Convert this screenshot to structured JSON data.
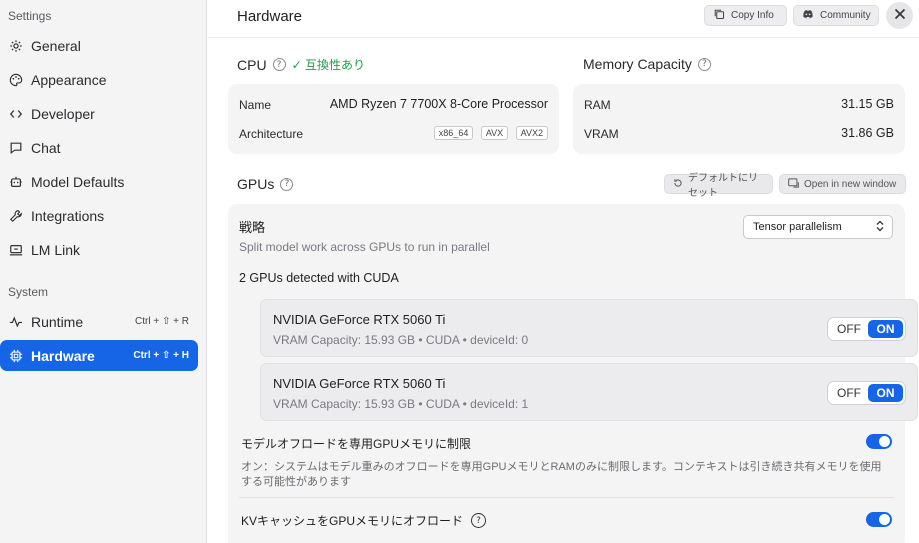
{
  "sidebar": {
    "settings_heading": "Settings",
    "system_heading": "System",
    "items": [
      {
        "label": "General",
        "icon": "gear-icon"
      },
      {
        "label": "Appearance",
        "icon": "palette-icon"
      },
      {
        "label": "Developer",
        "icon": "code-icon"
      },
      {
        "label": "Chat",
        "icon": "chat-icon"
      },
      {
        "label": "Model Defaults",
        "icon": "robot-icon"
      },
      {
        "label": "Integrations",
        "icon": "wrench-icon"
      },
      {
        "label": "LM Link",
        "icon": "link-icon"
      }
    ],
    "system_items": [
      {
        "label": "Runtime",
        "shortcut": "Ctrl + ⇧ + R",
        "icon": "activity-icon"
      },
      {
        "label": "Hardware",
        "shortcut": "Ctrl + ⇧ + H",
        "icon": "chip-icon",
        "active": true
      }
    ]
  },
  "header": {
    "title": "Hardware",
    "copy_info": "Copy Info",
    "community": "Community"
  },
  "cpu": {
    "title": "CPU",
    "compat": "互換性あり",
    "name_label": "Name",
    "name_value": "AMD Ryzen 7 7700X 8-Core Processor",
    "arch_label": "Architecture",
    "arch_tags": [
      "x86_64",
      "AVX",
      "AVX2"
    ]
  },
  "memory": {
    "title": "Memory Capacity",
    "ram_label": "RAM",
    "ram_value": "31.15 GB",
    "vram_label": "VRAM",
    "vram_value": "31.86 GB"
  },
  "gpus": {
    "title": "GPUs",
    "reset_label": "デフォルトにリセット",
    "open_window_label": "Open in new window",
    "strategy_label": "戦略",
    "strategy_desc": "Split model work across GPUs to run in parallel",
    "strategy_value": "Tensor parallelism",
    "detected": "2 GPUs detected with CUDA",
    "list": [
      {
        "name": "NVIDIA GeForce RTX 5060 Ti",
        "sub": "VRAM Capacity: 15.93 GB • CUDA • deviceId: 0",
        "off": "OFF",
        "on": "ON"
      },
      {
        "name": "NVIDIA GeForce RTX 5060 Ti",
        "sub": "VRAM Capacity: 15.93 GB • CUDA • deviceId: 1",
        "off": "OFF",
        "on": "ON"
      }
    ],
    "offload_label": "モデルオフロードを専用GPUメモリに制限",
    "offload_desc": "オン：システムはモデル重みのオフロードを専用GPUメモリとRAMのみに制限します。コンテキストは引き続き共有メモリを使用する可能性があります",
    "kv_label": "KVキャッシュをGPUメモリにオフロード",
    "accent": "#1565e6"
  }
}
